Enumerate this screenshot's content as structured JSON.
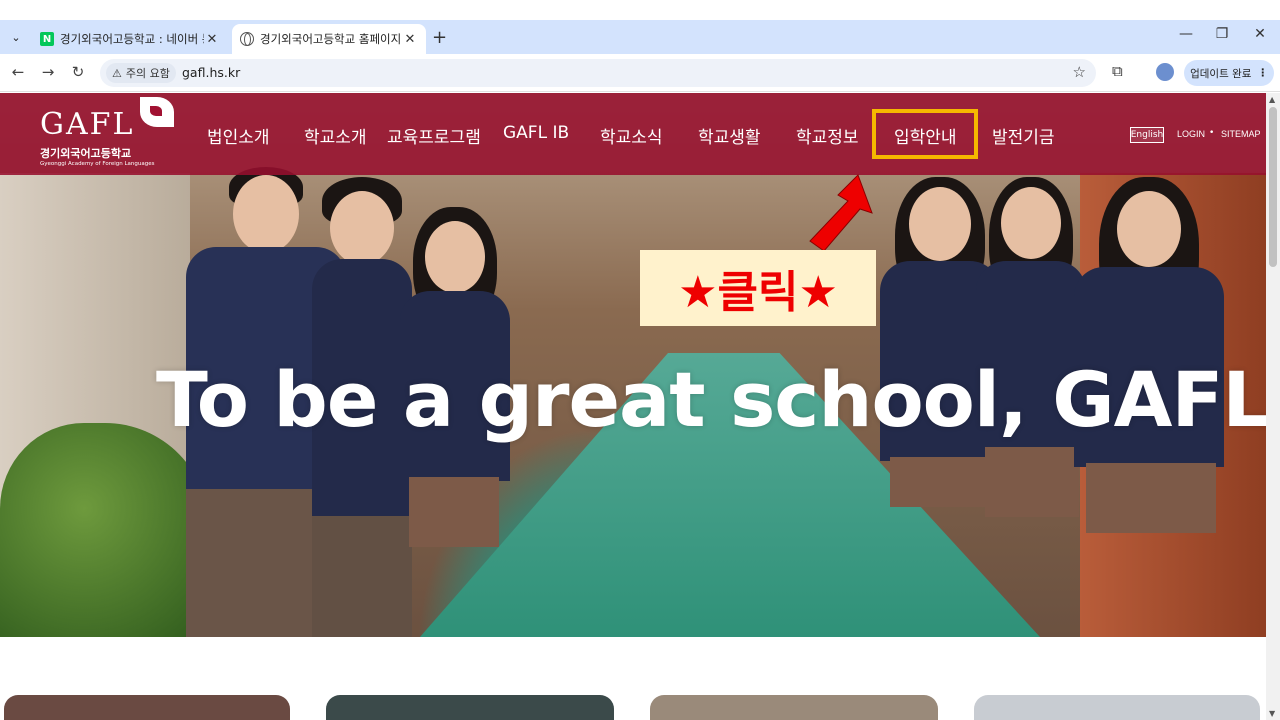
{
  "browser": {
    "tabs": [
      {
        "title": "경기외국어고등학교 : 네이버 통",
        "favicon": "naver-icon",
        "active": false
      },
      {
        "title": "경기외국어고등학교 홈페이지",
        "favicon": "globe-icon",
        "active": true
      }
    ],
    "new_tab": "+",
    "window_controls": {
      "minimize": "—",
      "restore": "❐",
      "close": "✕"
    },
    "nav": {
      "back": "←",
      "forward": "→",
      "reload": "↻"
    },
    "security_warning": "주의 요함",
    "url": "gafl.hs.kr",
    "update_button": "업데이트 완료",
    "menu_dots": "⋮"
  },
  "site": {
    "logo": {
      "mark": "GAFL",
      "name_ko": "경기외국어고등학교",
      "name_en": "Gyeonggi Academy of Foreign Languages"
    },
    "nav_items": [
      "법인소개",
      "학교소개",
      "교육프로그램",
      "GAFL IB",
      "학교소식",
      "학교생활",
      "학교정보",
      "입학안내",
      "발전기금"
    ],
    "highlighted_item": "입학안내",
    "lang": "English",
    "login": "LOGIN",
    "sitemap": "SITEMAP",
    "util_sep": "•",
    "hero_title": "To be a great school, GAFL"
  },
  "annotation": {
    "callout": "★클릭★",
    "box_color": "#f5b800",
    "arrow_color": "#ee0000"
  },
  "colors": {
    "header_bg": "#960f2d",
    "tabbar_bg": "#d3e3fd"
  }
}
